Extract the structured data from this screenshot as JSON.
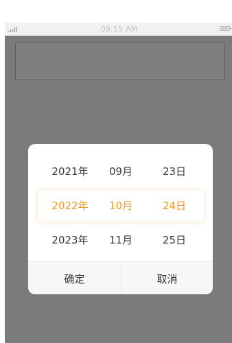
{
  "status_bar": {
    "time": "09:15 AM",
    "signal_icon": "signal-icon",
    "battery_icon": "battery-icon"
  },
  "date_input": {
    "value": ""
  },
  "picker": {
    "rows": [
      {
        "year": "2021年",
        "month": "09月",
        "day": "23日"
      },
      {
        "year": "2022年",
        "month": "10月",
        "day": "24日"
      },
      {
        "year": "2023年",
        "month": "11月",
        "day": "25日"
      }
    ],
    "selected_index": 1,
    "accent_color": "#f39617",
    "confirm_label": "确定",
    "cancel_label": "取消"
  }
}
